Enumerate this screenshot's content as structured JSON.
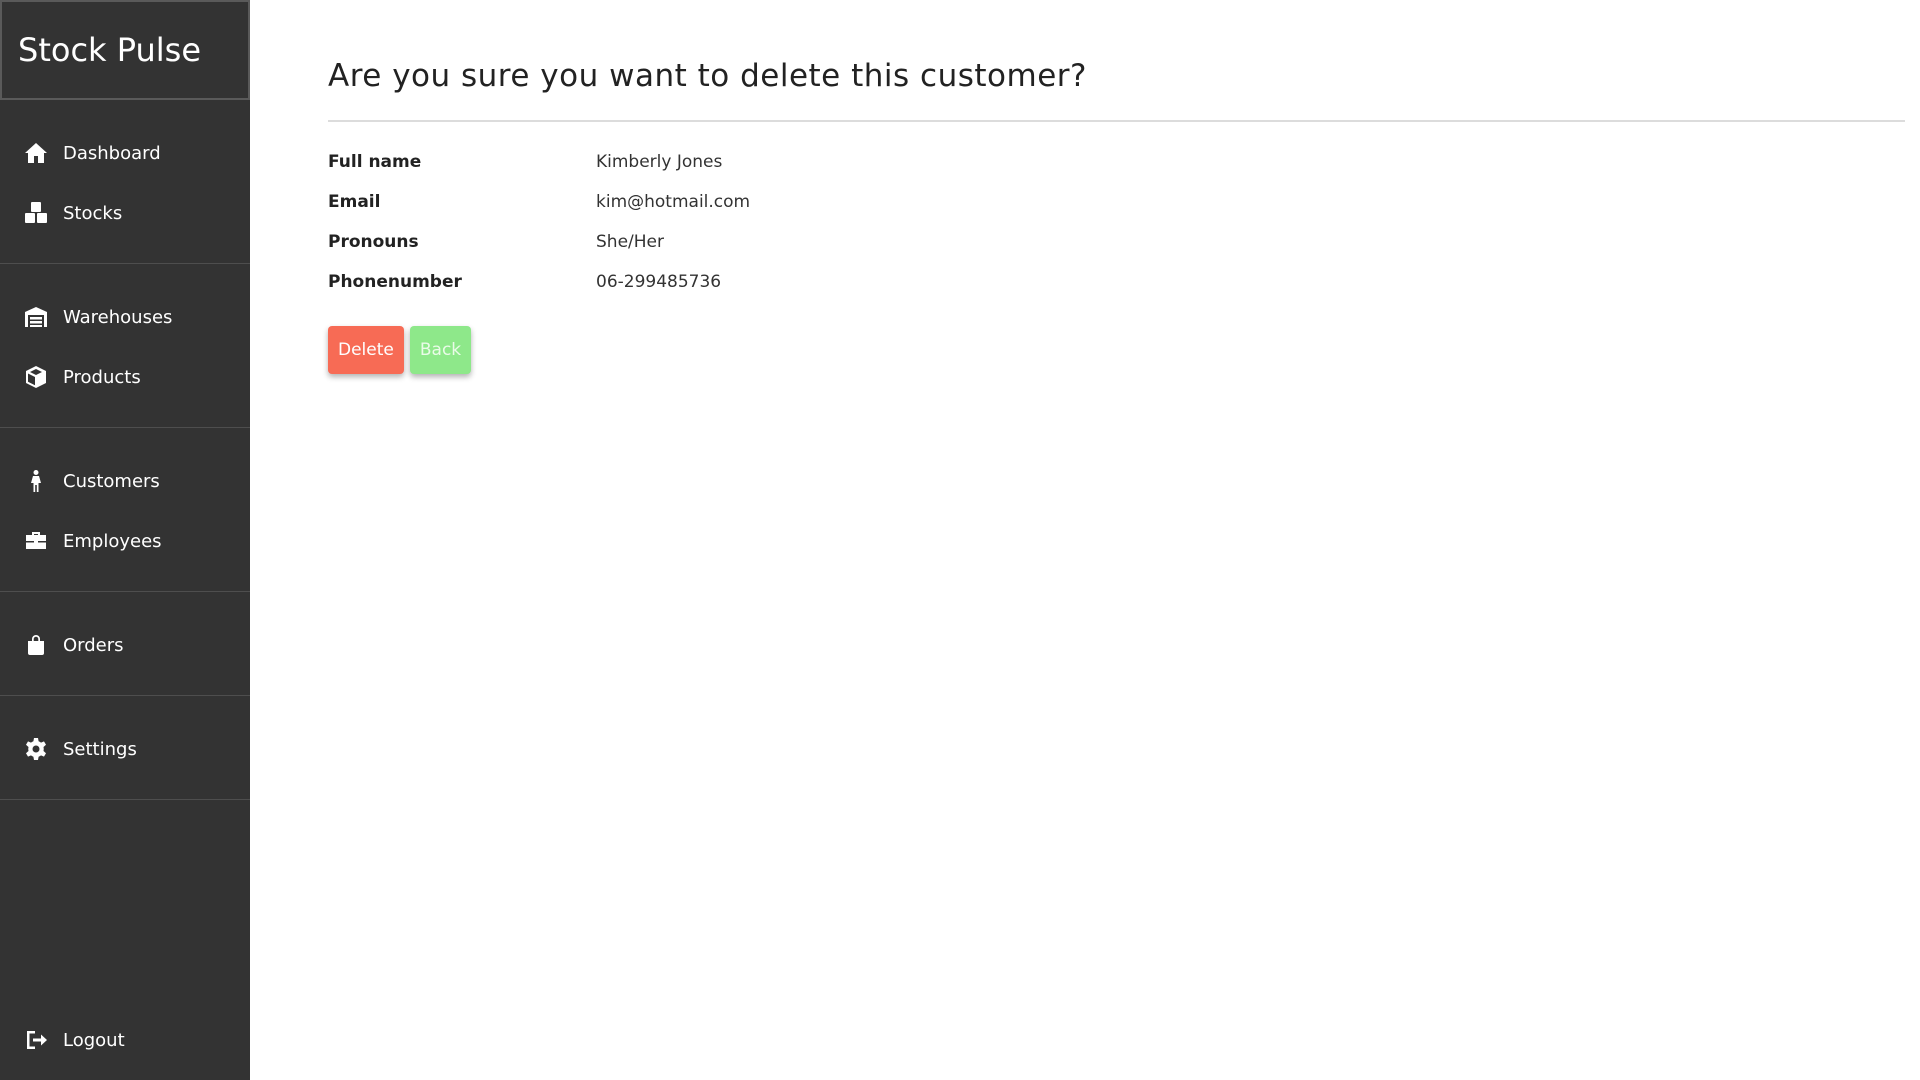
{
  "app": {
    "title": "Stock Pulse"
  },
  "sidebar": {
    "groups": [
      {
        "items": [
          {
            "label": "Dashboard",
            "icon": "home-icon"
          },
          {
            "label": "Stocks",
            "icon": "boxes-icon"
          }
        ]
      },
      {
        "items": [
          {
            "label": "Warehouses",
            "icon": "warehouse-icon"
          },
          {
            "label": "Products",
            "icon": "box-icon"
          }
        ]
      },
      {
        "items": [
          {
            "label": "Customers",
            "icon": "person-icon"
          },
          {
            "label": "Employees",
            "icon": "briefcase-icon"
          }
        ]
      },
      {
        "items": [
          {
            "label": "Orders",
            "icon": "shopping-bag-icon"
          }
        ]
      },
      {
        "items": [
          {
            "label": "Settings",
            "icon": "gear-icon"
          }
        ]
      }
    ],
    "logout": {
      "label": "Logout",
      "icon": "logout-icon"
    }
  },
  "main": {
    "title": "Are you sure you want to delete this customer?",
    "details": [
      {
        "label": "Full name",
        "value": "Kimberly Jones"
      },
      {
        "label": "Email",
        "value": "kim@hotmail.com"
      },
      {
        "label": "Pronouns",
        "value": "She/Her"
      },
      {
        "label": "Phonenumber",
        "value": "06-299485736"
      }
    ],
    "actions": {
      "delete_label": "Delete",
      "back_label": "Back"
    }
  },
  "colors": {
    "sidebar_bg": "#333333",
    "delete": "#f76b55",
    "back": "#8ee88a"
  }
}
